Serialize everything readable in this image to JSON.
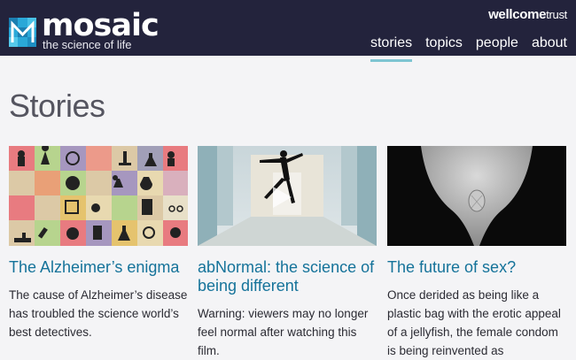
{
  "brand": {
    "name": "mosaic",
    "tagline": "the science of life",
    "partner_bold": "wellcome",
    "partner_light": "trust"
  },
  "nav": [
    {
      "label": "stories",
      "active": true
    },
    {
      "label": "topics",
      "active": false
    },
    {
      "label": "people",
      "active": false
    },
    {
      "label": "about",
      "active": false
    }
  ],
  "page": {
    "heading": "Stories"
  },
  "stories": [
    {
      "title": "The Alzheimer’s enigma",
      "summary": "The cause of Alzheimer’s disease has troubled the science world’s best detectives.",
      "image_icon": "mosaic-tile-grid-image"
    },
    {
      "title": "abNormal: the science of being different",
      "summary": "Warning: viewers may no longer feel normal after watching this film.",
      "image_icon": "leaping-dancer-video-image",
      "play_icon": "play-icon"
    },
    {
      "title": "The future of sex?",
      "summary": "Once derided as being like a plastic bag with the erotic appeal of a jellyfish, the female condom is being reinvented as",
      "image_icon": "female-condom-photo"
    }
  ],
  "colors": {
    "header_bg": "#23233c",
    "link_blue": "#15739a",
    "nav_underline": "#7ec5d2",
    "page_bg": "#f4f4f6"
  }
}
